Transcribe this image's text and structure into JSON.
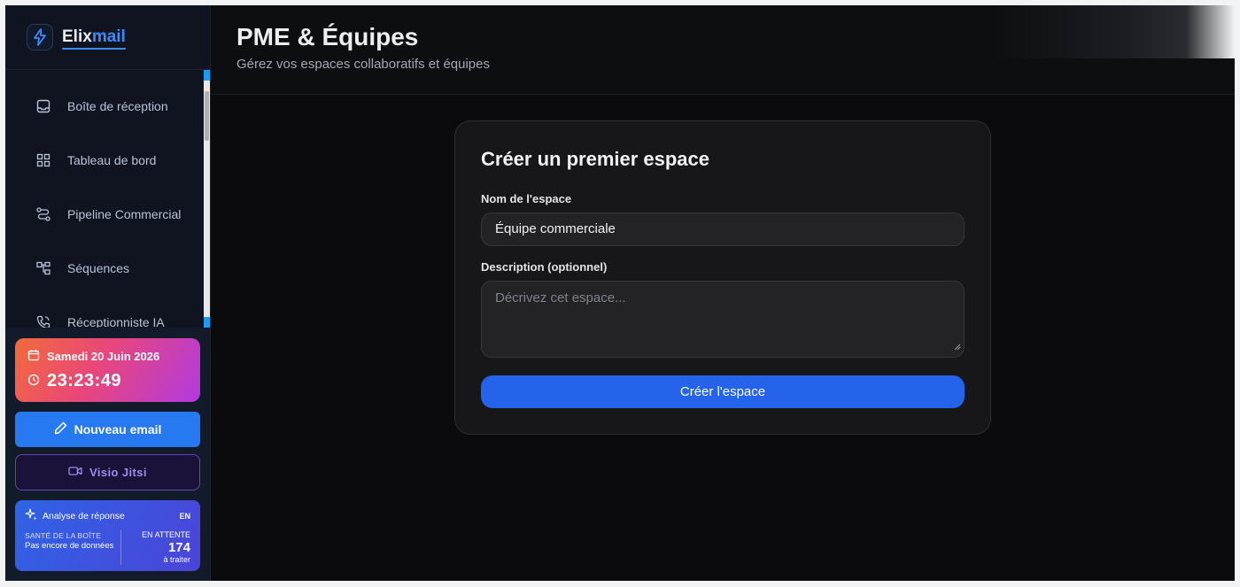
{
  "app": {
    "logo_part1": "Elix",
    "logo_part2": "mail"
  },
  "sidebar": {
    "items": [
      {
        "label": "Boîte de réception",
        "icon": "inbox-icon"
      },
      {
        "label": "Tableau de bord",
        "icon": "dashboard-icon"
      },
      {
        "label": "Pipeline Commercial",
        "icon": "route-icon"
      },
      {
        "label": "Séquences",
        "icon": "workflow-icon"
      },
      {
        "label": "Réceptionniste IA",
        "icon": "phone-icon"
      }
    ],
    "date": "Samedi 20 Juin 2026",
    "time": "23:23:49",
    "new_email_label": "Nouveau email",
    "visio_label": "Visio Jitsi",
    "analysis": {
      "title": "Analyse de réponse",
      "lang": "EN",
      "health_caption": "SANTÉ DE LA BOÎTE",
      "health_value": "Pas encore de données",
      "pending_caption": "EN ATTENTE",
      "pending_count": "174",
      "pending_suffix": "à traiter"
    }
  },
  "header": {
    "title": "PME & Équipes",
    "subtitle": "Gérez vos espaces collaboratifs et équipes"
  },
  "form": {
    "title": "Créer un premier espace",
    "name_label": "Nom de l'espace",
    "name_value": "Équipe commerciale",
    "description_label": "Description (optionnel)",
    "description_placeholder": "Décrivez cet espace...",
    "submit_label": "Créer l'espace"
  },
  "colors": {
    "primary_button": "#2563eb",
    "new_email_button": "#2679f0",
    "logo_accent": "#3a8dff"
  }
}
